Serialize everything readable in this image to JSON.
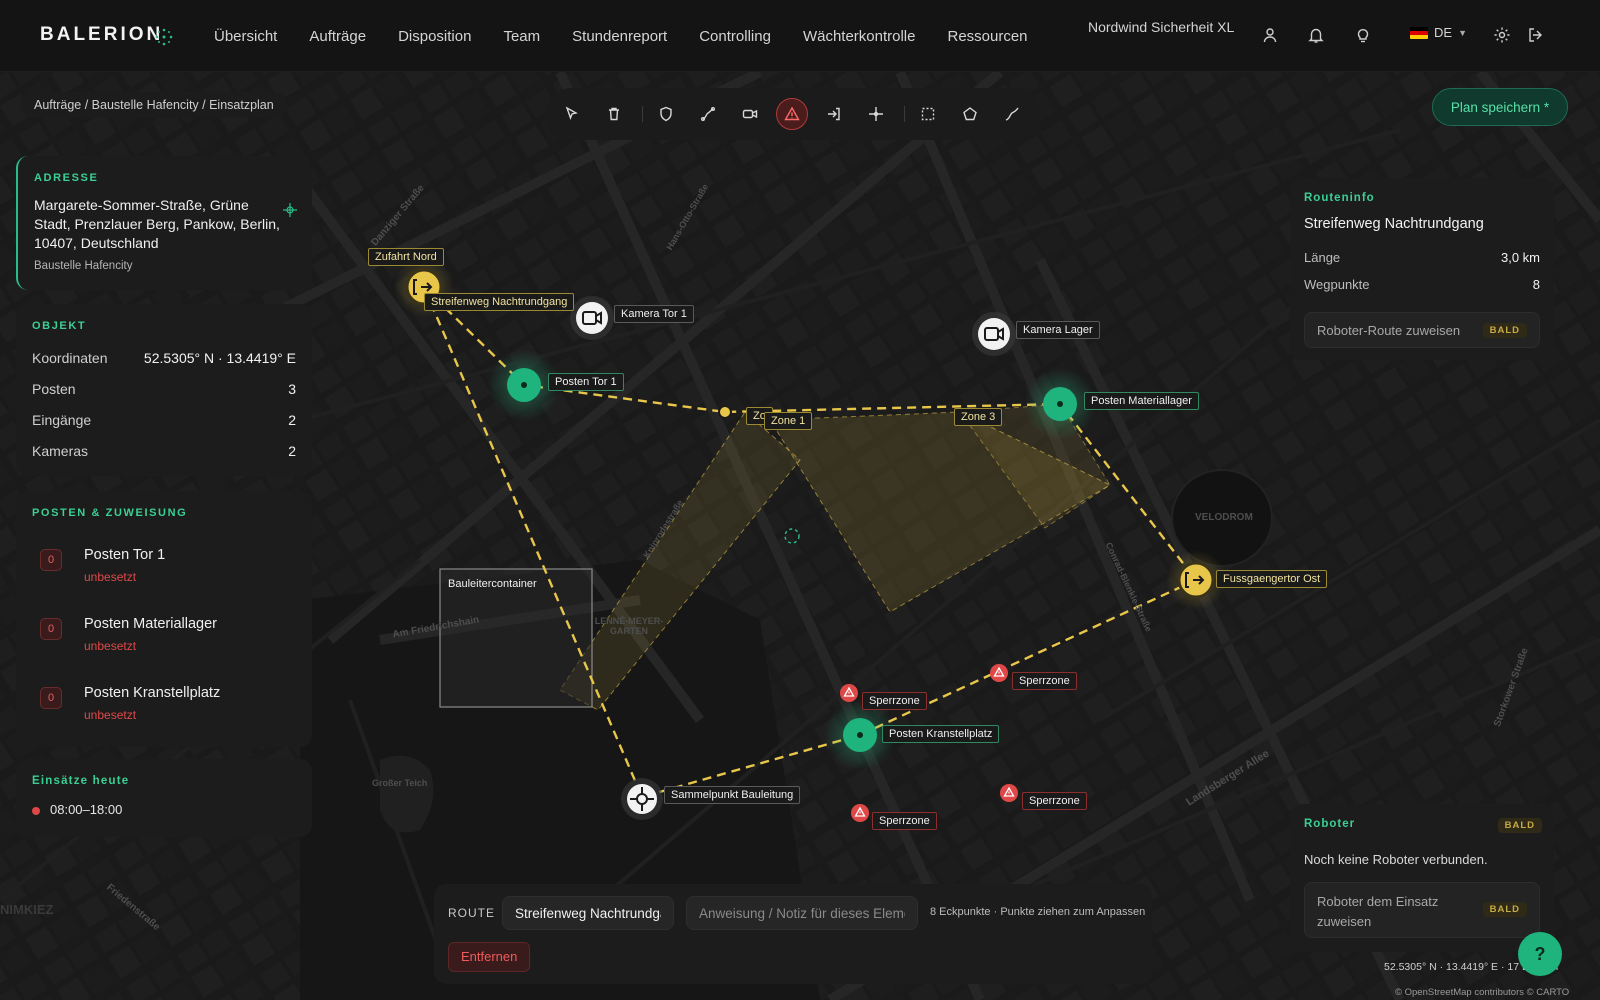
{
  "app": {
    "logo": "BALERION",
    "company": "Nordwind Sicherheit XL",
    "language": "DE"
  },
  "nav": [
    "Übersicht",
    "Aufträge",
    "Disposition",
    "Team",
    "Stundenreport",
    "Controlling",
    "Wächterkontrolle",
    "Ressourcen"
  ],
  "breadcrumb": "Aufträge / Baustelle Hafencity / Einsatzplan",
  "toolbar": {
    "tools": [
      "select-icon",
      "trash-icon",
      "shield-icon",
      "route-icon",
      "camera-icon",
      "warning-icon",
      "entrance-icon",
      "crosshair-icon",
      "selection-box-icon",
      "polygon-icon",
      "polyline-icon"
    ],
    "active_tool": "warning-icon"
  },
  "save_button": "Plan speichern *",
  "address": {
    "heading": "ADRESSE",
    "text": "Margarete-Sommer-Straße, Grüne Stadt, Prenzlauer Berg, Pankow, Berlin, 10407, Deutschland",
    "site": "Baustelle Hafencity"
  },
  "object": {
    "heading": "OBJEKT",
    "rows": [
      {
        "key": "Koordinaten",
        "value": "52.5305° N · 13.4419° E"
      },
      {
        "key": "Posten",
        "value": "3"
      },
      {
        "key": "Eingänge",
        "value": "2"
      },
      {
        "key": "Kameras",
        "value": "2"
      }
    ]
  },
  "posts": {
    "heading": "POSTEN & ZUWEISUNG",
    "items": [
      {
        "count": "0",
        "name": "Posten Tor 1",
        "status": "unbesetzt"
      },
      {
        "count": "0",
        "name": "Posten Materiallager",
        "status": "unbesetzt"
      },
      {
        "count": "0",
        "name": "Posten Kranstellplatz",
        "status": "unbesetzt"
      }
    ]
  },
  "today": {
    "heading": "Einsätze heute",
    "time": "08:00–18:00"
  },
  "route_info": {
    "heading": "Routeninfo",
    "title": "Streifenweg Nachtrundgang",
    "rows": [
      {
        "key": "Länge",
        "value": "3,0 km"
      },
      {
        "key": "Wegpunkte",
        "value": "8"
      }
    ],
    "button": "Roboter-Route zuweisen",
    "badge": "BALD"
  },
  "robot": {
    "heading": "Roboter",
    "badge": "BALD",
    "text": "Noch keine Roboter verbunden.",
    "button": "Roboter dem Einsatz zuweisen",
    "button_badge": "BALD"
  },
  "editor": {
    "label": "ROUTE",
    "name_value": "Streifenweg Nachtrundgang",
    "note_placeholder": "Anweisung / Notiz für dieses Element",
    "hint": "8 Eckpunkte · Punkte ziehen zum Anpassen",
    "remove": "Entfernen"
  },
  "map": {
    "labels": {
      "zufahrt_nord": "Zufahrt Nord",
      "route_name": "Streifenweg Nachtrundgang",
      "kamera_tor": "Kamera Tor 1",
      "kamera_lager": "Kamera Lager",
      "posten_tor": "Posten Tor 1",
      "posten_lager": "Posten Materiallager",
      "zone1_partial": "Zo",
      "zone1": "Zone 1",
      "zone3": "Zone 3",
      "fussgaenger": "Fussgaengertor Ost",
      "bauleiter": "Bauleitercontainer",
      "sperrzone": "Sperrzone",
      "posten_kran": "Posten Kranstellplatz",
      "sammelpunkt": "Sammelpunkt Bauleitung"
    },
    "street_names": [
      "Danziger Straße",
      "Kniprodestraße",
      "Am Friedrichshain",
      "Landsberger Allee",
      "Storkower Straße",
      "Friedenstraße",
      "Conrad-Blenkle-Straße",
      "Hans-Otto-Straße"
    ],
    "place_names": [
      "VELODROM",
      "LENNÉ-MEYER-GARTEN",
      "Großer Teich",
      "NIMKIEZ"
    ],
    "coords_readout": "52.5305° N · 13.4419° E · 17 Ebenen",
    "attribution": "© OpenStreetMap contributors © CARTO"
  },
  "help": "?",
  "colors": {
    "accent": "#2bbd87",
    "route": "#e8c64a",
    "danger": "#e04848",
    "badge": "#c7a945"
  }
}
